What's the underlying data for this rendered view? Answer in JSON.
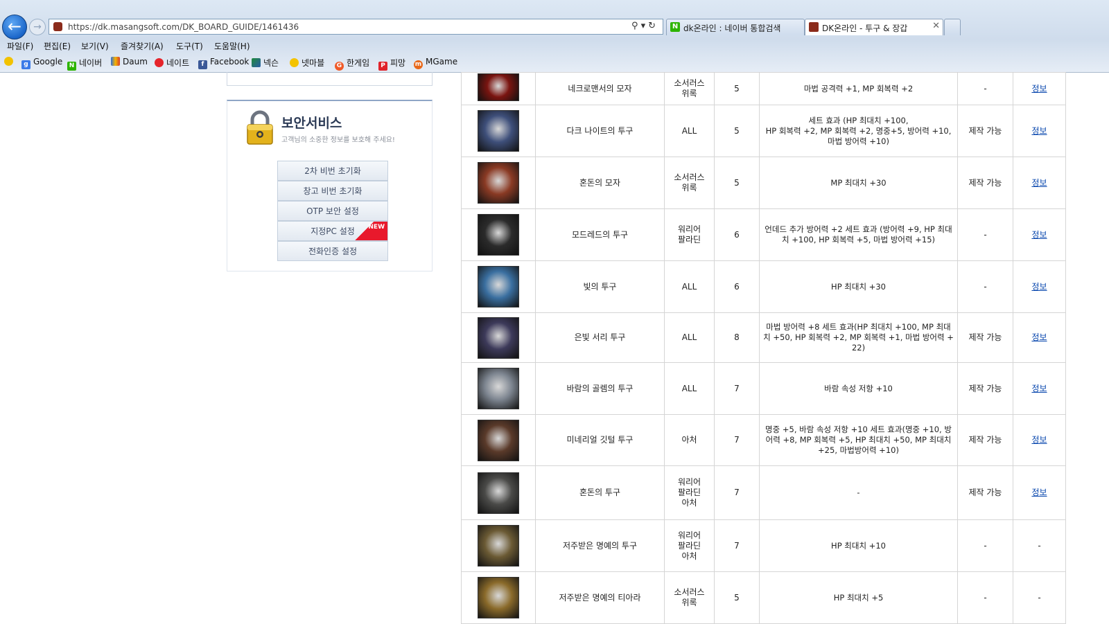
{
  "browser": {
    "url": "https://dk.masangsoft.com/DK_BOARD_GUIDE/1461436",
    "tabs": [
      {
        "label": "dk온라인 : 네이버 통합검색"
      },
      {
        "label": "DK온라인 - 투구 & 장갑"
      }
    ],
    "menu": [
      "파일(F)",
      "편집(E)",
      "보기(V)",
      "즐겨찾기(A)",
      "도구(T)",
      "도움말(H)"
    ],
    "favorites": [
      "Google",
      "네이버",
      "Daum",
      "네이트",
      "Facebook",
      "넥슨",
      "넷마블",
      "한게임",
      "피망",
      "MGame"
    ]
  },
  "sidebar": {
    "security": {
      "title": "보안서비스",
      "subtitle": "고객님의 소중한 정보를 보호해 주세요!",
      "buttons": [
        "2차 비번 초기화",
        "창고 비번 초기화",
        "OTP 보안 설정",
        "지정PC 설정",
        "전화인증 설정"
      ],
      "new_badge": "NEW"
    }
  },
  "table": {
    "rows": [
      {
        "name": "네크로맨서의 모자",
        "class": "소서러스\n위록",
        "level": "5",
        "effect": "마법 공격력 +1, MP 회복력 +2",
        "craft": "-",
        "info": "정보",
        "icon_color": "#7a1410"
      },
      {
        "name": "다크 나이트의 투구",
        "class": "ALL",
        "level": "5",
        "effect": "세트 효과 (HP 최대치 +100,\nHP 회복력 +2, MP 회복력 +2, 명중+5, 방어력 +10, 마법 방어력 +10)",
        "craft": "제작 가능",
        "info": "정보",
        "icon_color": "#3e4f7a"
      },
      {
        "name": "혼돈의 모자",
        "class": "소서러스\n위록",
        "level": "5",
        "effect": "MP 최대치 +30",
        "craft": "제작 가능",
        "info": "정보",
        "icon_color": "#8a3a24"
      },
      {
        "name": "모드레드의 투구",
        "class": "워리어\n팔라딘",
        "level": "6",
        "effect": "언데드 추가 방어력 +2 세트 효과 (방어력 +9, HP 최대치 +100, HP 회복력 +5, 마법 방어력 +15)",
        "craft": "-",
        "info": "정보",
        "icon_color": "#2b2b2b"
      },
      {
        "name": "빛의 투구",
        "class": "ALL",
        "level": "6",
        "effect": "HP 최대치 +30",
        "craft": "-",
        "info": "정보",
        "icon_color": "#3a6fa0"
      },
      {
        "name": "은빛 서리 투구",
        "class": "ALL",
        "level": "8",
        "effect": "마법 방어력 +8 세트 효과(HP 최대치 +100, MP 최대치 +50, HP 회복력 +2, MP 회복력 +1, 마법 방어력 +22)",
        "craft": "제작 가능",
        "info": "정보",
        "icon_color": "#3d3a5a"
      },
      {
        "name": "바람의 골렘의 투구",
        "class": "ALL",
        "level": "7",
        "effect": "바람 속성 저항 +10",
        "craft": "제작 가능",
        "info": "정보",
        "icon_color": "#7d8590"
      },
      {
        "name": "미네리얼 깃털 투구",
        "class": "아처",
        "level": "7",
        "effect": "명중 +5, 바람 속성 저항 +10 세트 효과(명중 +10, 방어력 +8, MP 회복력 +5, HP 최대치 +50, MP 최대치 +25, 마법방어력 +10)",
        "craft": "제작 가능",
        "info": "정보",
        "icon_color": "#5a3a2a"
      },
      {
        "name": "혼돈의 투구",
        "class": "워리어\n팔라딘\n아처",
        "level": "7",
        "effect": "-",
        "craft": "제작 가능",
        "info": "정보",
        "icon_color": "#4a4a48"
      },
      {
        "name": "저주받은 명예의 투구",
        "class": "워리어\n팔라딘\n아처",
        "level": "7",
        "effect": "HP 최대치 +10",
        "craft": "-",
        "info": "-",
        "icon_color": "#6b5a34"
      },
      {
        "name": "저주받은 명예의 티아라",
        "class": "소서러스\n위록",
        "level": "5",
        "effect": "HP 최대치 +5",
        "craft": "-",
        "info": "-",
        "icon_color": "#8a6a2a"
      }
    ]
  }
}
